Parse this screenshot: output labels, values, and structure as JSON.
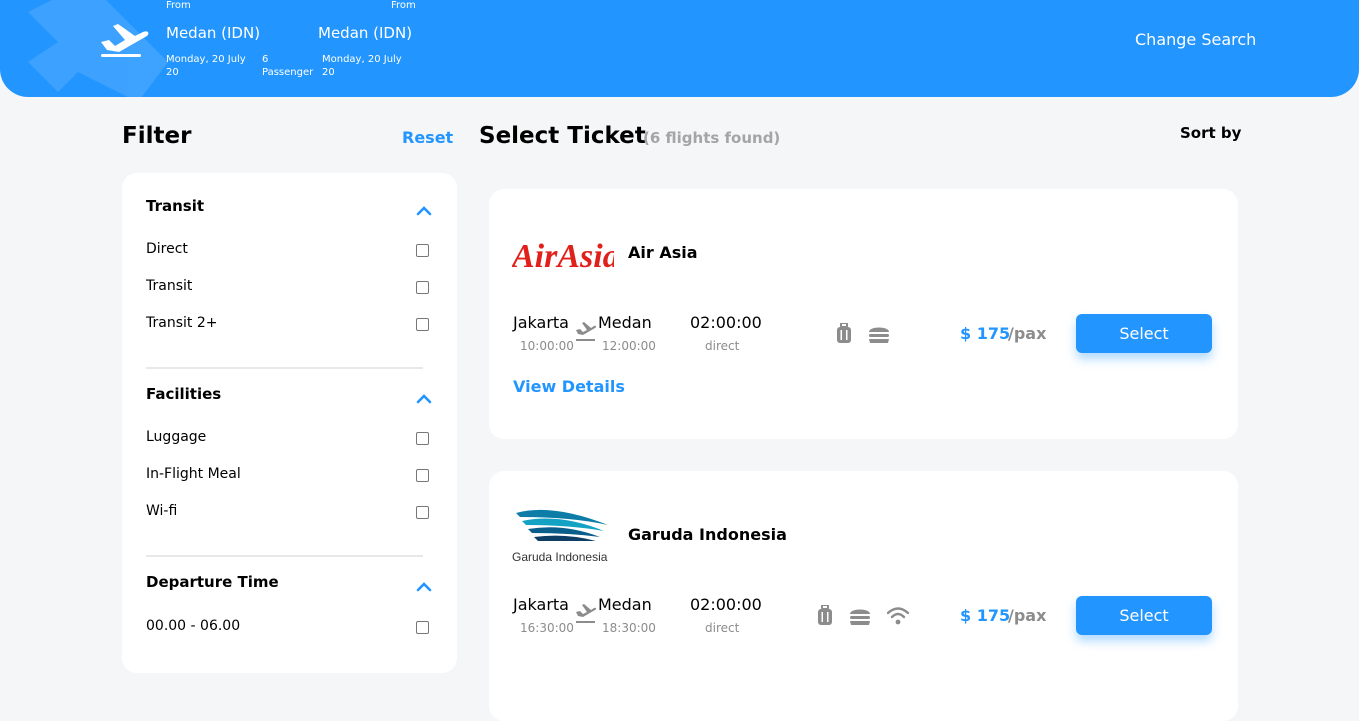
{
  "header": {
    "from_label_1": "From",
    "from_city_1": "Medan (IDN)",
    "date_1": "Monday, 20 July 20",
    "passenger": "6 Passenger",
    "from_label_2": "From",
    "from_city_2": "Medan (IDN)",
    "date_2": "Monday, 20 July 20",
    "change_search": "Change Search",
    "plane_icon": "plane-icon"
  },
  "filter": {
    "title": "Filter",
    "reset": "Reset",
    "sections": [
      {
        "title": "Transit",
        "options": [
          "Direct",
          "Transit",
          "Transit 2+"
        ]
      },
      {
        "title": "Facilities",
        "options": [
          "Luggage",
          "In-Flight Meal",
          "Wi-fi"
        ]
      },
      {
        "title": "Departure Time",
        "options": [
          "00.00 - 06.00"
        ]
      }
    ]
  },
  "main": {
    "title": "Select Ticket",
    "found": "(6 flights found)",
    "sort_by": "Sort by"
  },
  "tickets": [
    {
      "airline": "Air Asia",
      "logo_text": "AirAsia",
      "from_city": "Jakarta",
      "from_time": "10:00:00",
      "to_city": "Medan",
      "to_time": "12:00:00",
      "duration": "02:00:00",
      "type": "direct",
      "facilities": [
        "luggage-icon",
        "meal-icon"
      ],
      "price": "$ 175",
      "per": "/pax",
      "select": "Select",
      "view_details": "View Details"
    },
    {
      "airline": "Garuda Indonesia",
      "logo_text": "Garuda Indonesia",
      "from_city": "Jakarta",
      "from_time": "16:30:00",
      "to_city": "Medan",
      "to_time": "18:30:00",
      "duration": "02:00:00",
      "type": "direct",
      "facilities": [
        "luggage-icon",
        "meal-icon",
        "wifi-icon"
      ],
      "price": "$ 175",
      "per": "/pax",
      "select": "Select"
    }
  ],
  "colors": {
    "accent": "#2395ff",
    "muted": "#8c8c8c",
    "page_bg": "#f5f6f8"
  }
}
